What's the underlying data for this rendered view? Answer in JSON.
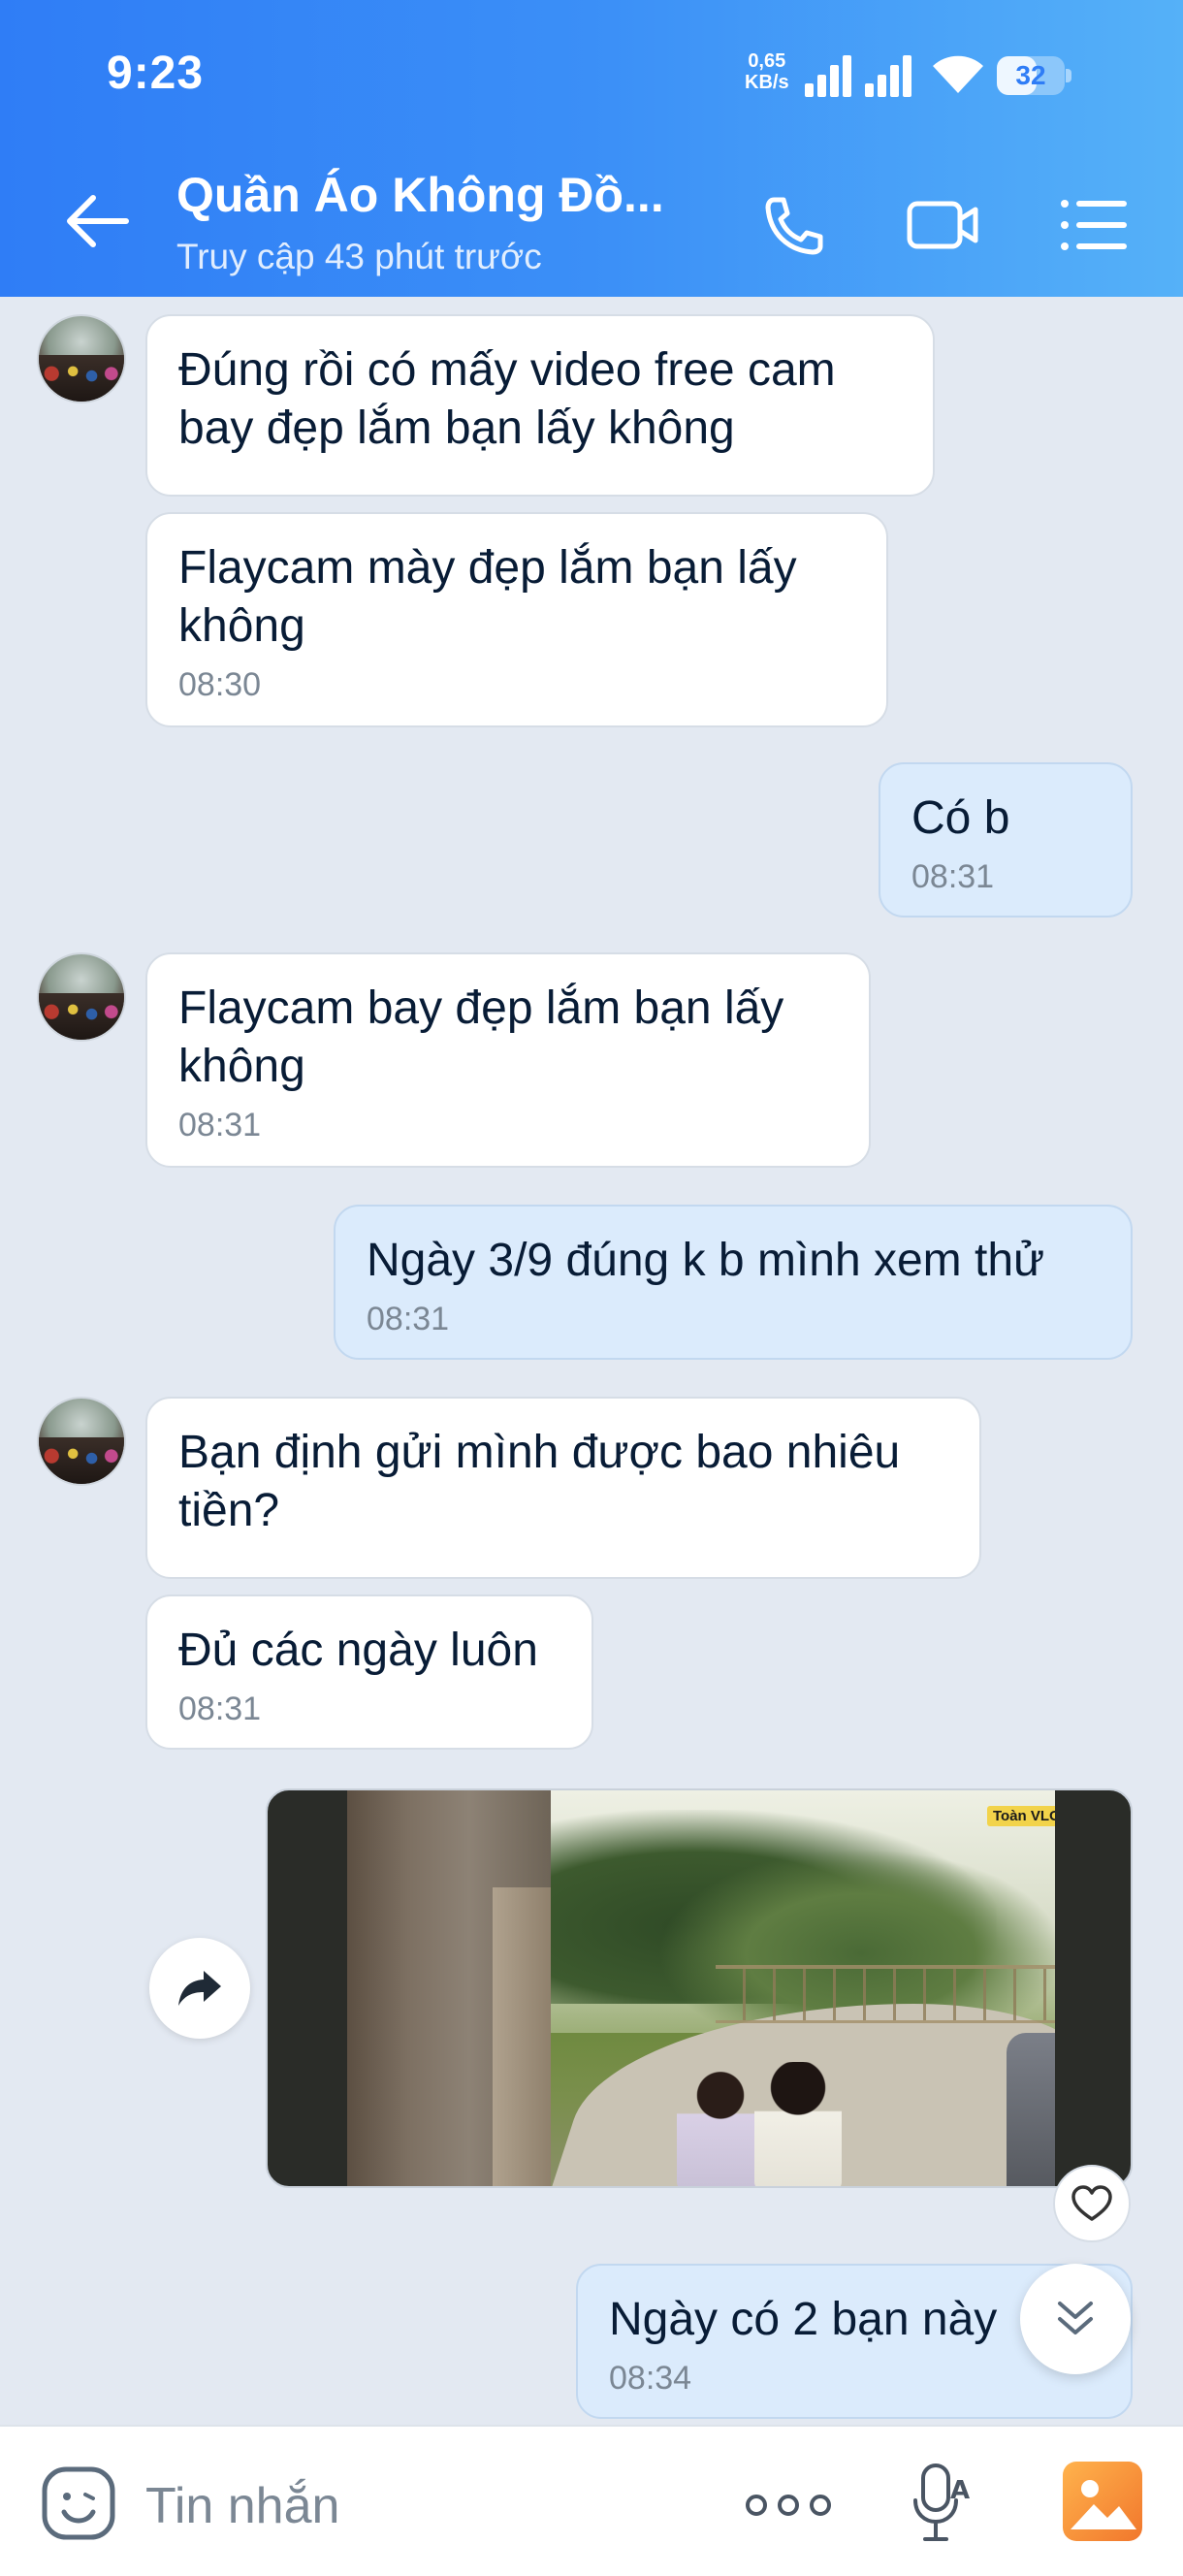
{
  "status_bar": {
    "time": "9:23",
    "net_speed_value": "0,65",
    "net_speed_unit": "KB/s",
    "battery": "32"
  },
  "header": {
    "title": "Quần Áo Không Đồ...",
    "subtitle": "Truy cập 43 phút trước"
  },
  "messages": [
    {
      "sender": "contact",
      "text": "Đúng rồi có mấy video free cam\nbay đẹp lắm bạn lấy không",
      "time": ""
    },
    {
      "sender": "contact",
      "text": "Flaycam mày đẹp lắm bạn lấy\nkhông",
      "time": "08:30"
    },
    {
      "sender": "me",
      "text": "Có b",
      "time": "08:31"
    },
    {
      "sender": "contact",
      "text": "Flaycam bay đẹp lắm bạn lấy\nkhông",
      "time": "08:31"
    },
    {
      "sender": "me",
      "text": "Ngày 3/9 đúng k b mình xem thử",
      "time": "08:31"
    },
    {
      "sender": "contact",
      "text": "Bạn định gửi mình được bao nhiêu\ntiền?",
      "time": ""
    },
    {
      "sender": "contact",
      "text": "Đủ các ngày luôn",
      "time": "08:31"
    },
    {
      "sender": "me",
      "text": "Ngày có 2 bạn này",
      "time": "08:34"
    }
  ],
  "video_attachment": {
    "watermark": "Toàn VLOG"
  },
  "input_bar": {
    "placeholder": "Tin nhắn"
  },
  "icons": {
    "back": "arrow-left-icon",
    "call": "phone-icon",
    "video": "video-camera-icon",
    "menu": "list-menu-icon",
    "share": "share-arrow-icon",
    "like": "heart-icon",
    "scroll_down": "double-chevron-down-icon",
    "emoji": "emoji-icon",
    "more": "more-dots-icon",
    "voice": "mic-icon",
    "photo": "image-icon"
  },
  "colors": {
    "header_start": "#2f7df6",
    "header_end": "#55b1f8",
    "chat_bg": "#e3e9f2",
    "incoming_bubble": "#ffffff",
    "outgoing_bubble": "#dbebfc"
  }
}
